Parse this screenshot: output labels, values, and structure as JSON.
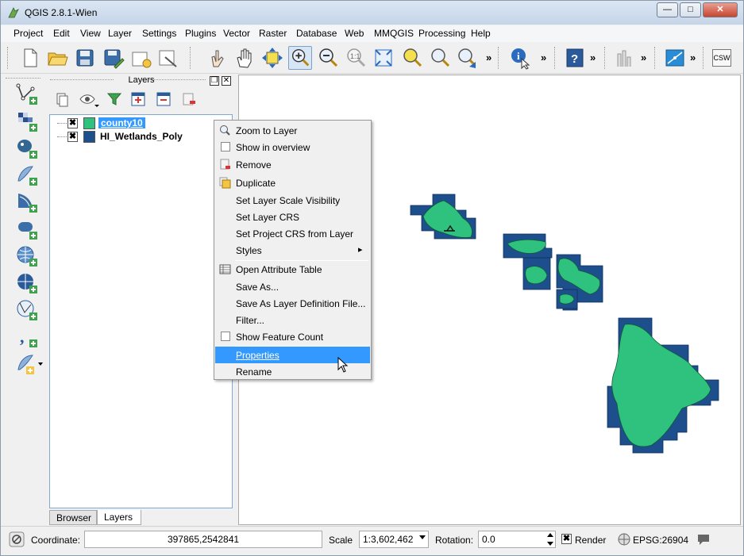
{
  "window": {
    "title": "QGIS 2.8.1-Wien",
    "minimize": "—",
    "maximize": "□",
    "close": "✕"
  },
  "menubar": [
    {
      "label": "Project"
    },
    {
      "label": "Edit"
    },
    {
      "label": "View"
    },
    {
      "label": "Layer"
    },
    {
      "label": "Settings"
    },
    {
      "label": "Plugins"
    },
    {
      "label": "Vector"
    },
    {
      "label": "Raster"
    },
    {
      "label": "Database"
    },
    {
      "label": "Web"
    },
    {
      "label": "MMQGIS"
    },
    {
      "label": "Processing"
    },
    {
      "label": "Help"
    }
  ],
  "toolbar": {
    "more": "»",
    "csw_label": "CSW"
  },
  "layers_panel": {
    "title": "Layers",
    "float_btn": "❐",
    "close_btn": "✕",
    "layers": [
      {
        "name": "county10",
        "checked": "✖",
        "color": "#2ec27e",
        "selected": true
      },
      {
        "name": "HI_Wetlands_Poly",
        "checked": "✖",
        "color": "#1c4f8c",
        "selected": false
      }
    ],
    "tabs": [
      "Browser",
      "Layers"
    ]
  },
  "context_menu": {
    "items": [
      {
        "label": "Zoom to Layer",
        "icon": "zoom-icon"
      },
      {
        "label": "Show in overview",
        "icon": "checkbox"
      },
      {
        "label": "Remove",
        "icon": "remove-icon"
      },
      {
        "label": "Duplicate",
        "icon": "duplicate-icon"
      },
      {
        "label": "Set Layer Scale Visibility",
        "icon": ""
      },
      {
        "label": "Set Layer CRS",
        "icon": ""
      },
      {
        "label": "Set Project CRS from Layer",
        "icon": ""
      },
      {
        "label": "Styles",
        "icon": ""
      },
      {
        "label": "Open Attribute Table",
        "icon": "table-icon"
      },
      {
        "label": "Save As...",
        "icon": ""
      },
      {
        "label": "Save As Layer Definition File...",
        "icon": ""
      },
      {
        "label": "Filter...",
        "icon": ""
      },
      {
        "label": "Show Feature Count",
        "icon": "checkbox"
      },
      {
        "label": "Properties",
        "icon": "",
        "highlighted": true
      },
      {
        "label": "Rename",
        "icon": ""
      }
    ],
    "submenu_arrow": "▸"
  },
  "statusbar": {
    "coordinate_label": "Coordinate:",
    "coordinate_value": "397865,2542841",
    "scale_label": "Scale",
    "scale_value": "1:3,602,462",
    "rotation_label": "Rotation:",
    "rotation_value": "0.0",
    "render_label": "Render",
    "render_checked": "✖",
    "crs_label": "EPSG:26904"
  },
  "colors": {
    "county_fill": "#2ec27e",
    "wetland_fill": "#1c4f8c",
    "selection": "#3399ff"
  }
}
